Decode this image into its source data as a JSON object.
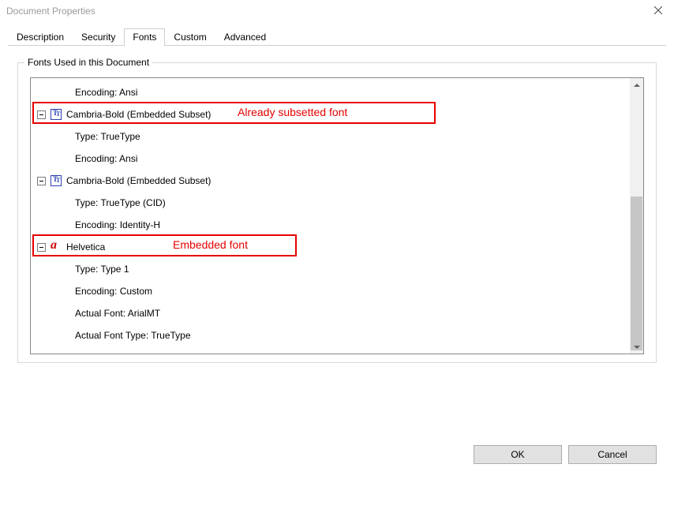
{
  "window": {
    "title": "Document Properties"
  },
  "tabs": [
    {
      "label": "Description"
    },
    {
      "label": "Security"
    },
    {
      "label": "Fonts"
    },
    {
      "label": "Custom"
    },
    {
      "label": "Advanced"
    }
  ],
  "active_tab_index": 2,
  "group": {
    "legend": "Fonts Used in this Document"
  },
  "tree": [
    {
      "level": 1,
      "text": "Encoding: Ansi"
    },
    {
      "level": 0,
      "icon": "tt",
      "text": "Cambria-Bold (Embedded Subset)",
      "expander": true
    },
    {
      "level": 1,
      "text": "Type: TrueType"
    },
    {
      "level": 1,
      "text": "Encoding: Ansi"
    },
    {
      "level": 0,
      "icon": "tt",
      "text": "Cambria-Bold (Embedded Subset)",
      "expander": true
    },
    {
      "level": 1,
      "text": "Type: TrueType (CID)"
    },
    {
      "level": 1,
      "text": "Encoding: Identity-H"
    },
    {
      "level": 0,
      "icon": "a",
      "text": "Helvetica",
      "expander": true
    },
    {
      "level": 1,
      "text": "Type: Type 1"
    },
    {
      "level": 1,
      "text": "Encoding: Custom"
    },
    {
      "level": 1,
      "text": "Actual Font: ArialMT"
    },
    {
      "level": 1,
      "text": "Actual Font Type: TrueType"
    }
  ],
  "annotations": [
    {
      "index": 1,
      "label": "Already subsetted font"
    },
    {
      "index": 7,
      "label": "Embedded font"
    }
  ],
  "buttons": {
    "ok": "OK",
    "cancel": "Cancel"
  }
}
